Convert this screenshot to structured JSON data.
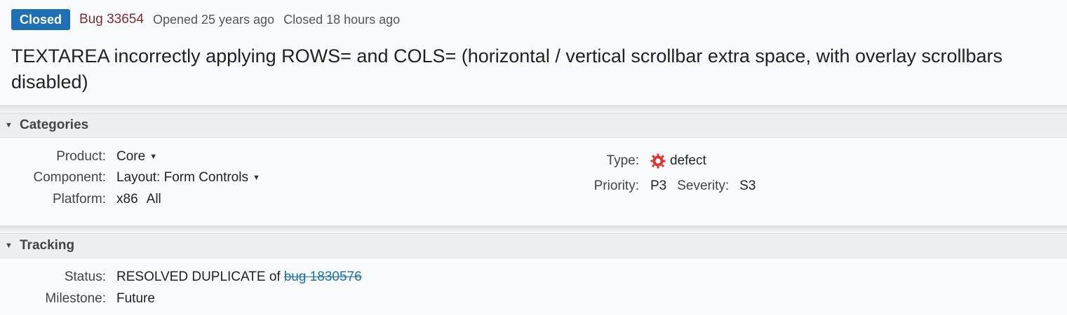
{
  "header": {
    "status_badge": "Closed",
    "bug_id": "Bug 33654",
    "opened": "Opened 25 years ago",
    "closed": "Closed 18 hours ago",
    "title": "TEXTAREA incorrectly applying ROWS= and COLS= (horizontal / vertical scrollbar extra space, with overlay scrollbars disabled)"
  },
  "categories": {
    "section_label": "Categories",
    "product_label": "Product:",
    "product_value": "Core",
    "component_label": "Component:",
    "component_value": "Layout: Form Controls",
    "platform_label": "Platform:",
    "platform_arch": "x86",
    "platform_os": "All",
    "type_label": "Type:",
    "type_value": "defect",
    "priority_label": "Priority:",
    "priority_value": "P3",
    "severity_label": "Severity:",
    "severity_value": "S3"
  },
  "tracking": {
    "section_label": "Tracking",
    "status_label": "Status:",
    "status_value": "RESOLVED DUPLICATE of",
    "duplicate_link": "bug 1830576",
    "milestone_label": "Milestone:",
    "milestone_value": "Future"
  },
  "colors": {
    "accent": "#1f6fb5",
    "bug_link": "#7a2e2e",
    "defect_icon": "#e0322f"
  },
  "icons": {
    "collapse": "triangle-down-icon",
    "dropdown": "caret-down-icon",
    "defect": "defect-bug-icon"
  }
}
